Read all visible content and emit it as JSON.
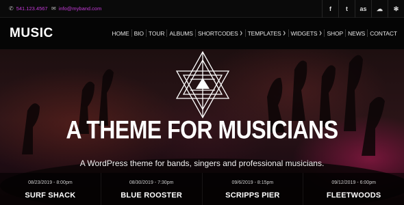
{
  "topbar": {
    "phone": "541.123.4567",
    "email": "info@myband.com",
    "phone_icon": "phone-icon",
    "email_icon": "envelope-icon",
    "social": [
      {
        "icon": "facebook-icon",
        "glyph": "f"
      },
      {
        "icon": "twitter-icon",
        "glyph": "t"
      },
      {
        "icon": "lastfm-icon",
        "glyph": "as"
      },
      {
        "icon": "soundcloud-icon",
        "glyph": "☁"
      },
      {
        "icon": "yelp-icon",
        "glyph": "✻"
      }
    ]
  },
  "header": {
    "logo": "MUSIC",
    "nav": [
      {
        "label": "HOME"
      },
      {
        "label": "BIO"
      },
      {
        "label": "TOUR"
      },
      {
        "label": "ALBUMS"
      },
      {
        "label": "SHORTCODES",
        "dropdown": true
      },
      {
        "label": "TEMPLATES",
        "dropdown": true
      },
      {
        "label": "WIDGETS",
        "dropdown": true
      },
      {
        "label": "SHOP"
      },
      {
        "label": "NEWS"
      },
      {
        "label": "CONTACT"
      }
    ]
  },
  "hero": {
    "title": "A THEME FOR MUSICIANS",
    "subtitle": "A WordPress theme for bands, singers and professional musicians."
  },
  "events": [
    {
      "date": "08/23/2019 - 8:00pm",
      "name": "SURF SHACK"
    },
    {
      "date": "08/30/2019 - 7:30pm",
      "name": "BLUE ROOSTER"
    },
    {
      "date": "09/6/2019 - 8:15pm",
      "name": "SCRIPPS PIER"
    },
    {
      "date": "09/12/2019 - 6:00pm",
      "name": "FLEETWOODS"
    }
  ],
  "colors": {
    "accent": "#c23ad6",
    "background": "#000000"
  }
}
